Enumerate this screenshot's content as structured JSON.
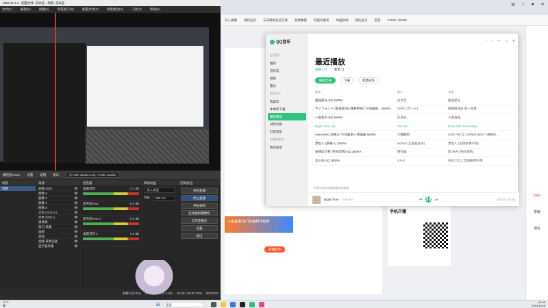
{
  "obs": {
    "title": "OBS 31.1.2 - 配置文件: 未命名 - 场景: 未命名",
    "menu": [
      "文件(F)",
      "编辑(E)",
      "视图(V)",
      "停靠窗口(D)",
      "配置文件(P)",
      "场景集合(S)",
      "工具(T)",
      "帮助(H)"
    ],
    "ctrl": {
      "scene_label": "康祖直Vtube",
      "properties": "设置",
      "filters": "滤镜",
      "window_label": "窗口",
      "window_value": "[VTube Studio.exe]: VTube Studio"
    },
    "docks": {
      "scenes": "场景",
      "sources": "来源",
      "mixer": "混音器",
      "transitions": "转场动画",
      "controls": "控制按钮"
    },
    "scenes": [
      "场景"
    ],
    "sources": [
      "图像 0000",
      "图像 2",
      "图像 3",
      "图像 4",
      "图像 5",
      "文本 (GDI+) 2",
      "文本 (GDI+)",
      "媒体源",
      "窗口 采集",
      "画图",
      "游戏",
      "视频 采集设备",
      "显示器采集"
    ],
    "mixer": [
      {
        "name": "桌面音频",
        "db": "-2.2 dB"
      },
      {
        "name": "麦克风/Aux",
        "db": "-0.0 dB"
      },
      {
        "name": "麦克风/Aux 2",
        "db": "-0.0 dB"
      },
      {
        "name": "桌面音频 2",
        "db": "0.0 dB"
      }
    ],
    "transition": {
      "type": "淡入淡出",
      "duration_label": "时长",
      "duration": "300 ms"
    },
    "controls": [
      "开始直播",
      "停止直播",
      "开始录制",
      "启动虚拟摄像机",
      "工作室模式",
      "设置",
      "退出"
    ],
    "status": {
      "frames": "丢帧 0 (0.0%)",
      "kbps": "0 kb/s",
      "cpu": "CPU: 2.3%",
      "fps": "60.00 / 60.00 FPS",
      "time": "00:00:00"
    }
  },
  "qq": {
    "logo": "QQ音乐",
    "sidebar_sections": [
      "在线音乐",
      "我的音乐"
    ],
    "nav_online": [
      "推荐",
      "音乐馆",
      "视频",
      "雷达"
    ],
    "nav_mine": [
      "我喜欢",
      "本地和下载",
      "最近播放",
      "试听列表",
      "已购音乐"
    ],
    "nav_created": [
      "创建的歌单",
      "我的歌单"
    ],
    "page_title": "最近播放",
    "tabs": [
      "歌曲 678",
      "歌单 11"
    ],
    "actions": [
      "播放全部",
      "下载",
      "批量操作"
    ],
    "cols": [
      "歌曲",
      "歌手",
      "专辑"
    ],
    "songs": [
      {
        "t": "超强星光 SQ 360RA",
        "ar": "吴文莹",
        "al": "超强星光"
      },
      {
        "t": "サイフォンド (附录歌词) (版权所有) TV动画第... 360RA",
        "ar": "ZARD (ザード)",
        "al": "麻雀牌球员 第一乐章"
      },
      {
        "t": "一直有声 SQ 360RA",
        "ar": "乱月光",
        "al": "人生海海"
      },
      {
        "t": "Night Time SQ",
        "ar": "The Rio",
        "al": "Dust With Secondary"
      },
      {
        "t": "memories (剑姬2) TV动画第一话插曲 360RA",
        "ar": "大疆翻唱",
        "al": "ONE PIECE SUPER BEST (海贼王..."
      },
      {
        "t": "梦追人 (原来人) 360RA",
        "ar": "KOKIA (吉田亚纪子)",
        "al": "梦追人 (王牌新闻学院)"
      },
      {
        "t": "右侧幻之祈 (空间涂鸦) SQ 360RA",
        "ar": "西打猫",
        "al": "影·乐光 (空间涂鸦)"
      },
      {
        "t": "怎么办 SQ 360RA",
        "ar": "S.H.E",
        "al": "生在少年上 电视剧原声带"
      }
    ],
    "bottom_note": "列表中含有非播放版本的歌曲",
    "player": {
      "song": "Night Time",
      "artist": "The Rio",
      "time": "00:02 / 04:35"
    }
  },
  "browser": {
    "bookmarks": [
      "导入收藏",
      "微软主页",
      "天天网络安全交易",
      "爱媒数据",
      "阿里云服务",
      "中国移动",
      "我的主页",
      "百度",
      "STEEL GEMS"
    ],
    "right_rail": [
      "扫码",
      "客服",
      "建议"
    ],
    "card_title": "手机开播",
    "card_cta": "开播助手",
    "banner": "斗鱼直播 热门封面制作指南"
  },
  "taskbar": {
    "search": "搜索",
    "weather_temp": "11°C",
    "weather_desc": "晴",
    "clock_time": "00:06",
    "clock_date": "2024/12/26"
  }
}
